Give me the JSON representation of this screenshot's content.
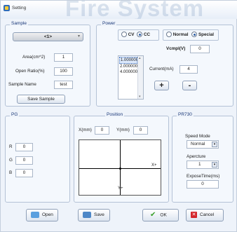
{
  "window": {
    "title": "Setting",
    "watermark": "Fire System"
  },
  "sample": {
    "legend": "Sample",
    "selector": "<1>",
    "area_label": "Area(cm^2)",
    "area_value": "1",
    "open_ratio_label": "Open Ratio(%)",
    "open_ratio_value": "100",
    "sample_name_label": "Sample Name",
    "sample_name_value": "test",
    "save_sample_label": "Save Sample"
  },
  "power": {
    "legend": "Power",
    "cv_label": "CV",
    "cc_label": "CC",
    "normal_label": "Normal",
    "special_label": "Special",
    "vcmpl_label": "Vcmpl(V)",
    "vcmpl_value": "0",
    "list_items": [
      "1.000000",
      "2.000000",
      "4.000000"
    ],
    "current_label": "Current(mA)",
    "current_value": "4",
    "plus_label": "+",
    "minus_label": "-"
  },
  "pg": {
    "legend": "PG",
    "r_label": "R",
    "r_value": "0",
    "g_label": "G",
    "g_value": "0",
    "b_label": "B",
    "b_value": "0"
  },
  "position": {
    "legend": "Position",
    "x_label": "X(mm)",
    "x_value": "0",
    "y_label": "Y(mm)",
    "y_value": "0",
    "xaxis_label": "X+",
    "yaxis_label": "Y+"
  },
  "pr730": {
    "legend": "PR730",
    "speed_mode_label": "Speed Mode",
    "speed_mode_value": "Normal",
    "aperture_label": "Apercture",
    "aperture_value": "1",
    "exposure_label": "ExposeTime(ms)",
    "exposure_value": "0"
  },
  "footer": {
    "open_label": "Open",
    "save_label": "Save",
    "ok_label": "OK",
    "cancel_label": "Cancel"
  }
}
